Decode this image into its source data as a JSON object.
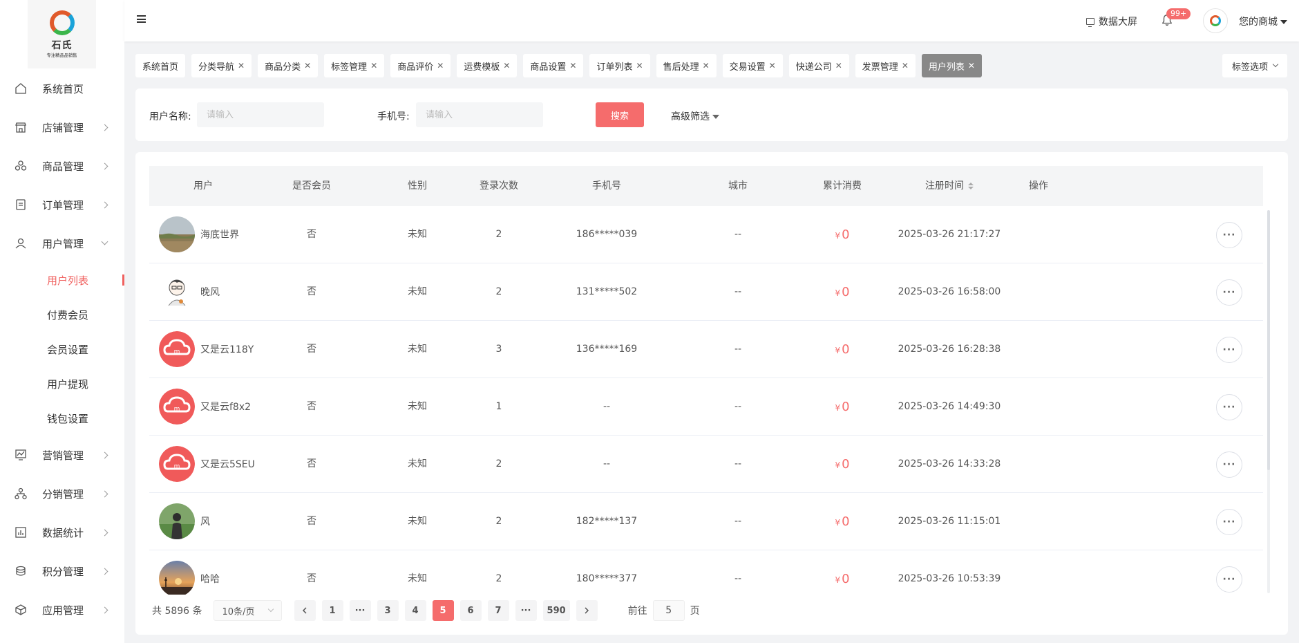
{
  "logo": {
    "title": "石氏",
    "subtitle": "专注精品品销售"
  },
  "sidebar": {
    "items": [
      {
        "label": "系统首页",
        "icon": "home-icon",
        "expandable": false
      },
      {
        "label": "店铺管理",
        "icon": "store-icon",
        "expandable": true
      },
      {
        "label": "商品管理",
        "icon": "goods-icon",
        "expandable": true
      },
      {
        "label": "订单管理",
        "icon": "order-icon",
        "expandable": true
      },
      {
        "label": "用户管理",
        "icon": "user-icon",
        "expandable": true,
        "expanded": true
      }
    ],
    "submenu": [
      {
        "label": "用户列表",
        "active": true
      },
      {
        "label": "付费会员"
      },
      {
        "label": "会员设置"
      },
      {
        "label": "用户提现"
      },
      {
        "label": "钱包设置"
      }
    ],
    "items_after": [
      {
        "label": "营销管理",
        "icon": "marketing-icon"
      },
      {
        "label": "分销管理",
        "icon": "distribution-icon"
      },
      {
        "label": "数据统计",
        "icon": "stats-icon"
      },
      {
        "label": "积分管理",
        "icon": "points-icon"
      },
      {
        "label": "应用管理",
        "icon": "apps-icon"
      }
    ]
  },
  "header": {
    "bigscreen_label": "数据大屏",
    "notification_badge": "99+",
    "store_name": "您的商城"
  },
  "tags": [
    {
      "label": "系统首页",
      "closable": false
    },
    {
      "label": "分类导航",
      "closable": true
    },
    {
      "label": "商品分类",
      "closable": true
    },
    {
      "label": "标签管理",
      "closable": true
    },
    {
      "label": "商品评价",
      "closable": true
    },
    {
      "label": "运费模板",
      "closable": true
    },
    {
      "label": "商品设置",
      "closable": true
    },
    {
      "label": "订单列表",
      "closable": true
    },
    {
      "label": "售后处理",
      "closable": true
    },
    {
      "label": "交易设置",
      "closable": true
    },
    {
      "label": "快递公司",
      "closable": true
    },
    {
      "label": "发票管理",
      "closable": true
    },
    {
      "label": "用户列表",
      "closable": true,
      "active": true
    }
  ],
  "tag_options_label": "标签选项",
  "filter": {
    "username_label": "用户名称:",
    "username_placeholder": "请输入",
    "phone_label": "手机号:",
    "phone_placeholder": "请输入",
    "search_label": "搜索",
    "advanced_label": "高级筛选"
  },
  "table": {
    "columns": [
      "用户",
      "是否会员",
      "性别",
      "登录次数",
      "手机号",
      "城市",
      "累计消费",
      "注册时间",
      "操作"
    ],
    "currency": "¥",
    "rows": [
      {
        "name": "海底世界",
        "avatar": "landscape",
        "member": "否",
        "gender": "未知",
        "logins": "2",
        "phone": "186*****039",
        "city": "--",
        "spent": "0",
        "registered": "2025-03-26 21:17:27"
      },
      {
        "name": "晚风",
        "avatar": "cartoon",
        "member": "否",
        "gender": "未知",
        "logins": "2",
        "phone": "131*****502",
        "city": "--",
        "spent": "0",
        "registered": "2025-03-26 16:58:00"
      },
      {
        "name": "又是云118Y",
        "avatar": "cloud",
        "member": "否",
        "gender": "未知",
        "logins": "3",
        "phone": "136*****169",
        "city": "--",
        "spent": "0",
        "registered": "2025-03-26 16:28:38"
      },
      {
        "name": "又是云f8x2",
        "avatar": "cloud",
        "member": "否",
        "gender": "未知",
        "logins": "1",
        "phone": "--",
        "city": "--",
        "spent": "0",
        "registered": "2025-03-26 14:49:30"
      },
      {
        "name": "又是云5SEU",
        "avatar": "cloud",
        "member": "否",
        "gender": "未知",
        "logins": "2",
        "phone": "--",
        "city": "--",
        "spent": "0",
        "registered": "2025-03-26 14:33:28"
      },
      {
        "name": "风",
        "avatar": "person",
        "member": "否",
        "gender": "未知",
        "logins": "2",
        "phone": "182*****137",
        "city": "--",
        "spent": "0",
        "registered": "2025-03-26 11:15:01"
      },
      {
        "name": "哈哈",
        "avatar": "sunset",
        "member": "否",
        "gender": "未知",
        "logins": "2",
        "phone": "180*****377",
        "city": "--",
        "spent": "0",
        "registered": "2025-03-26 10:53:39"
      }
    ],
    "more_label": "···"
  },
  "pagination": {
    "total": "共 5896 条",
    "page_size": "10条/页",
    "pages": [
      "1",
      "···",
      "3",
      "4",
      "5",
      "6",
      "7",
      "···",
      "590"
    ],
    "current": "5",
    "goto_prefix": "前往",
    "goto_value": "5",
    "goto_suffix": "页"
  },
  "colors": {
    "accent": "#f56c6c",
    "active_tag": "#888888"
  }
}
